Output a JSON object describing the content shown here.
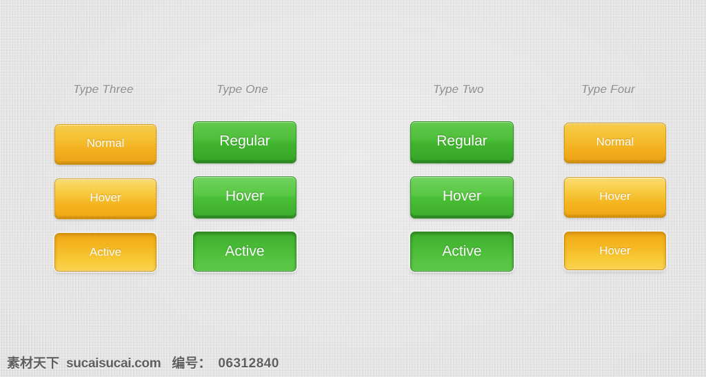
{
  "page": {
    "background_color": "#e5e5e5",
    "texture": "linen-weave"
  },
  "columns": [
    {
      "label": "Type Three",
      "theme": "orange",
      "accent": "#f2ae1d",
      "buttons": [
        {
          "label": "Normal",
          "state": "normal"
        },
        {
          "label": "Hover",
          "state": "hover"
        },
        {
          "label": "Active",
          "state": "active"
        }
      ]
    },
    {
      "label": "Type One",
      "theme": "green",
      "accent": "#42b62f",
      "buttons": [
        {
          "label": "Regular",
          "state": "normal"
        },
        {
          "label": "Hover",
          "state": "hover"
        },
        {
          "label": "Active",
          "state": "active"
        }
      ]
    },
    {
      "label": "Type Two",
      "theme": "green",
      "accent": "#42b62f",
      "buttons": [
        {
          "label": "Regular",
          "state": "normal"
        },
        {
          "label": "Hover",
          "state": "hover"
        },
        {
          "label": "Active",
          "state": "active"
        }
      ]
    },
    {
      "label": "Type Four",
      "theme": "orange",
      "accent": "#f2ae1d",
      "buttons": [
        {
          "label": "Normal",
          "state": "normal"
        },
        {
          "label": "Hover",
          "state": "hover"
        },
        {
          "label": "Hover",
          "state": "active"
        }
      ]
    }
  ],
  "footer": {
    "brand": "素材天下",
    "site": "sucaisucai.com",
    "id_label": "编号：",
    "id_number": "06312840"
  }
}
